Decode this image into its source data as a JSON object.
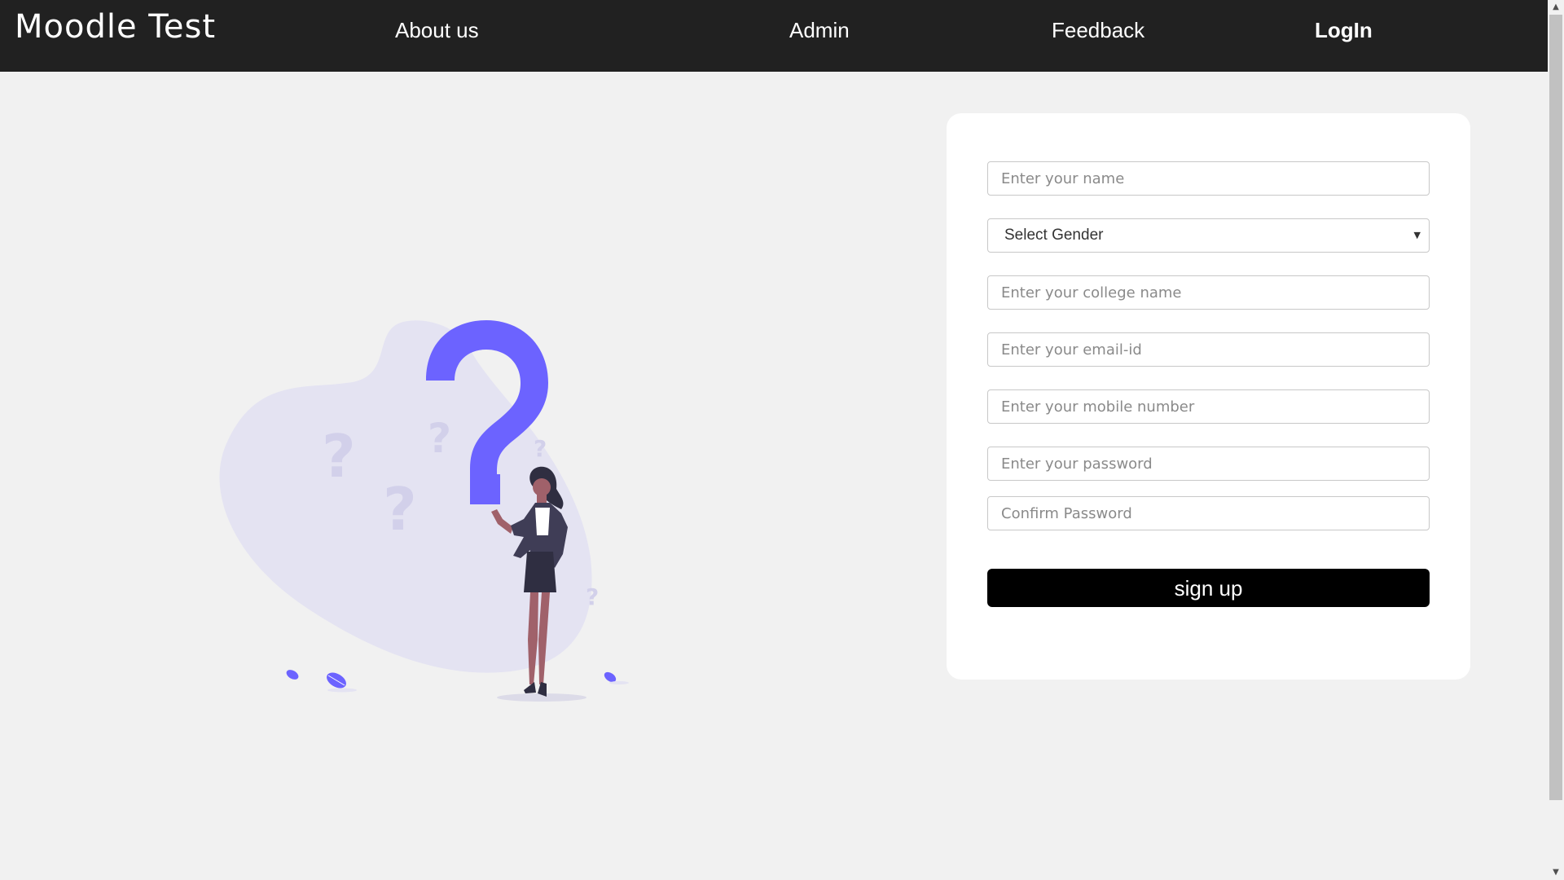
{
  "navbar": {
    "brand": "Moodle Test",
    "links": [
      {
        "label": "About us"
      },
      {
        "label": "Admin"
      },
      {
        "label": "Feedback"
      },
      {
        "label": "LogIn"
      }
    ]
  },
  "form": {
    "name_placeholder": "Enter your name",
    "gender_selected": "Select Gender",
    "college_placeholder": "Enter your college name",
    "email_placeholder": "Enter your email-id",
    "mobile_placeholder": "Enter your mobile number",
    "password_placeholder": "Enter your password",
    "confirm_placeholder": "Confirm Password",
    "submit_label": "sign up"
  },
  "illustration": {
    "icon": "question-woman-illustration",
    "accent_color": "#6c63ff",
    "blob_color": "#e4e3f2"
  },
  "colors": {
    "navbar_bg": "#212121",
    "page_bg": "#f1f1f1",
    "button_bg": "#000000"
  }
}
